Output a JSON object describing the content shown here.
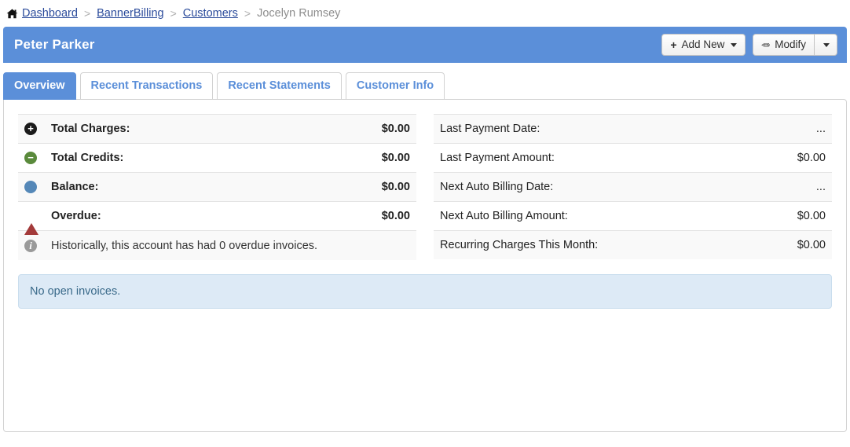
{
  "breadcrumb": {
    "home_icon": "home-icon",
    "separator": ">",
    "items": [
      {
        "label": "Dashboard",
        "link": true
      },
      {
        "label": "BannerBilling",
        "link": true
      },
      {
        "label": "Customers",
        "link": true
      },
      {
        "label": "Jocelyn Rumsey",
        "link": false
      }
    ]
  },
  "header": {
    "title": "Peter Parker",
    "accent_color": "#5b8fd9",
    "add_new_label": "Add New",
    "add_new_icon": "plus-icon",
    "modify_label": "Modify",
    "modify_icon": "pencil-icon",
    "caret_icon": "caret-down-icon"
  },
  "tabs": [
    {
      "label": "Overview",
      "active": true
    },
    {
      "label": "Recent Transactions",
      "active": false
    },
    {
      "label": "Recent Statements",
      "active": false
    },
    {
      "label": "Customer Info",
      "active": false
    }
  ],
  "summary_left": {
    "rows": [
      {
        "icon": "plus-circle-icon",
        "label": "Total Charges:",
        "value": "$0.00",
        "bold": true
      },
      {
        "icon": "minus-circle-icon",
        "label": "Total Credits:",
        "value": "$0.00",
        "bold": true
      },
      {
        "icon": "balance-circle-icon",
        "label": "Balance:",
        "value": "$0.00",
        "bold": true
      },
      {
        "icon": "warning-triangle-icon",
        "label": "Overdue:",
        "value": "$0.00",
        "bold": true
      }
    ],
    "note": {
      "icon": "info-circle-icon",
      "text": "Historically, this account has had 0 overdue invoices."
    }
  },
  "summary_right": {
    "rows": [
      {
        "label": "Last Payment Date:",
        "value": "..."
      },
      {
        "label": "Last Payment Amount:",
        "value": "$0.00"
      },
      {
        "label": "Next Auto Billing Date:",
        "value": "..."
      },
      {
        "label": "Next Auto Billing Amount:",
        "value": "$0.00"
      },
      {
        "label": "Recurring Charges This Month:",
        "value": "$0.00"
      }
    ]
  },
  "invoices_alert": {
    "text": "No open invoices.",
    "background": "#ddeaf6",
    "text_color": "#3a6a8a"
  },
  "icons": {
    "plus": "+",
    "minus": "–",
    "info": "i",
    "home": "⌂"
  }
}
